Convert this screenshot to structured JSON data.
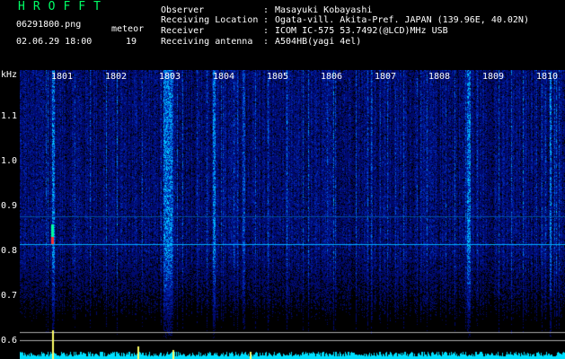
{
  "brand": "HROFFT",
  "file": {
    "name": "06291800.png",
    "datetime": "02.06.29 18:00"
  },
  "meteor": {
    "label": "meteor",
    "count": "19"
  },
  "info": [
    {
      "key": "Observer",
      "sep": ":",
      "value": "Masayuki Kobayashi"
    },
    {
      "key": "Receiving Location",
      "sep": ":",
      "value": "Ogata-vill. Akita-Pref. JAPAN (139.96E, 40.02N)"
    },
    {
      "key": "Receiver",
      "sep": ":",
      "value": "ICOM IC-575 53.7492(@LCD)MHz USB"
    },
    {
      "key": "Receiving antenna",
      "sep": ":",
      "value": "A504HB(yagi 4el)"
    }
  ],
  "axis": {
    "y_unit": "kHz",
    "y_ticks": [
      "1.1",
      "1.0",
      "0.9",
      "0.8",
      "0.7",
      "0.6"
    ],
    "x_ticks": [
      "1801",
      "1802",
      "1803",
      "1804",
      "1805",
      "1806",
      "1807",
      "1808",
      "1809",
      "1810"
    ]
  },
  "colors": {
    "background": "#000000",
    "spectrogram_base": "#00005a",
    "echo": "#00c8ff",
    "meteor_hit": "#ff3030",
    "baseline": "#ffff66",
    "brand": "#00ff66"
  }
}
